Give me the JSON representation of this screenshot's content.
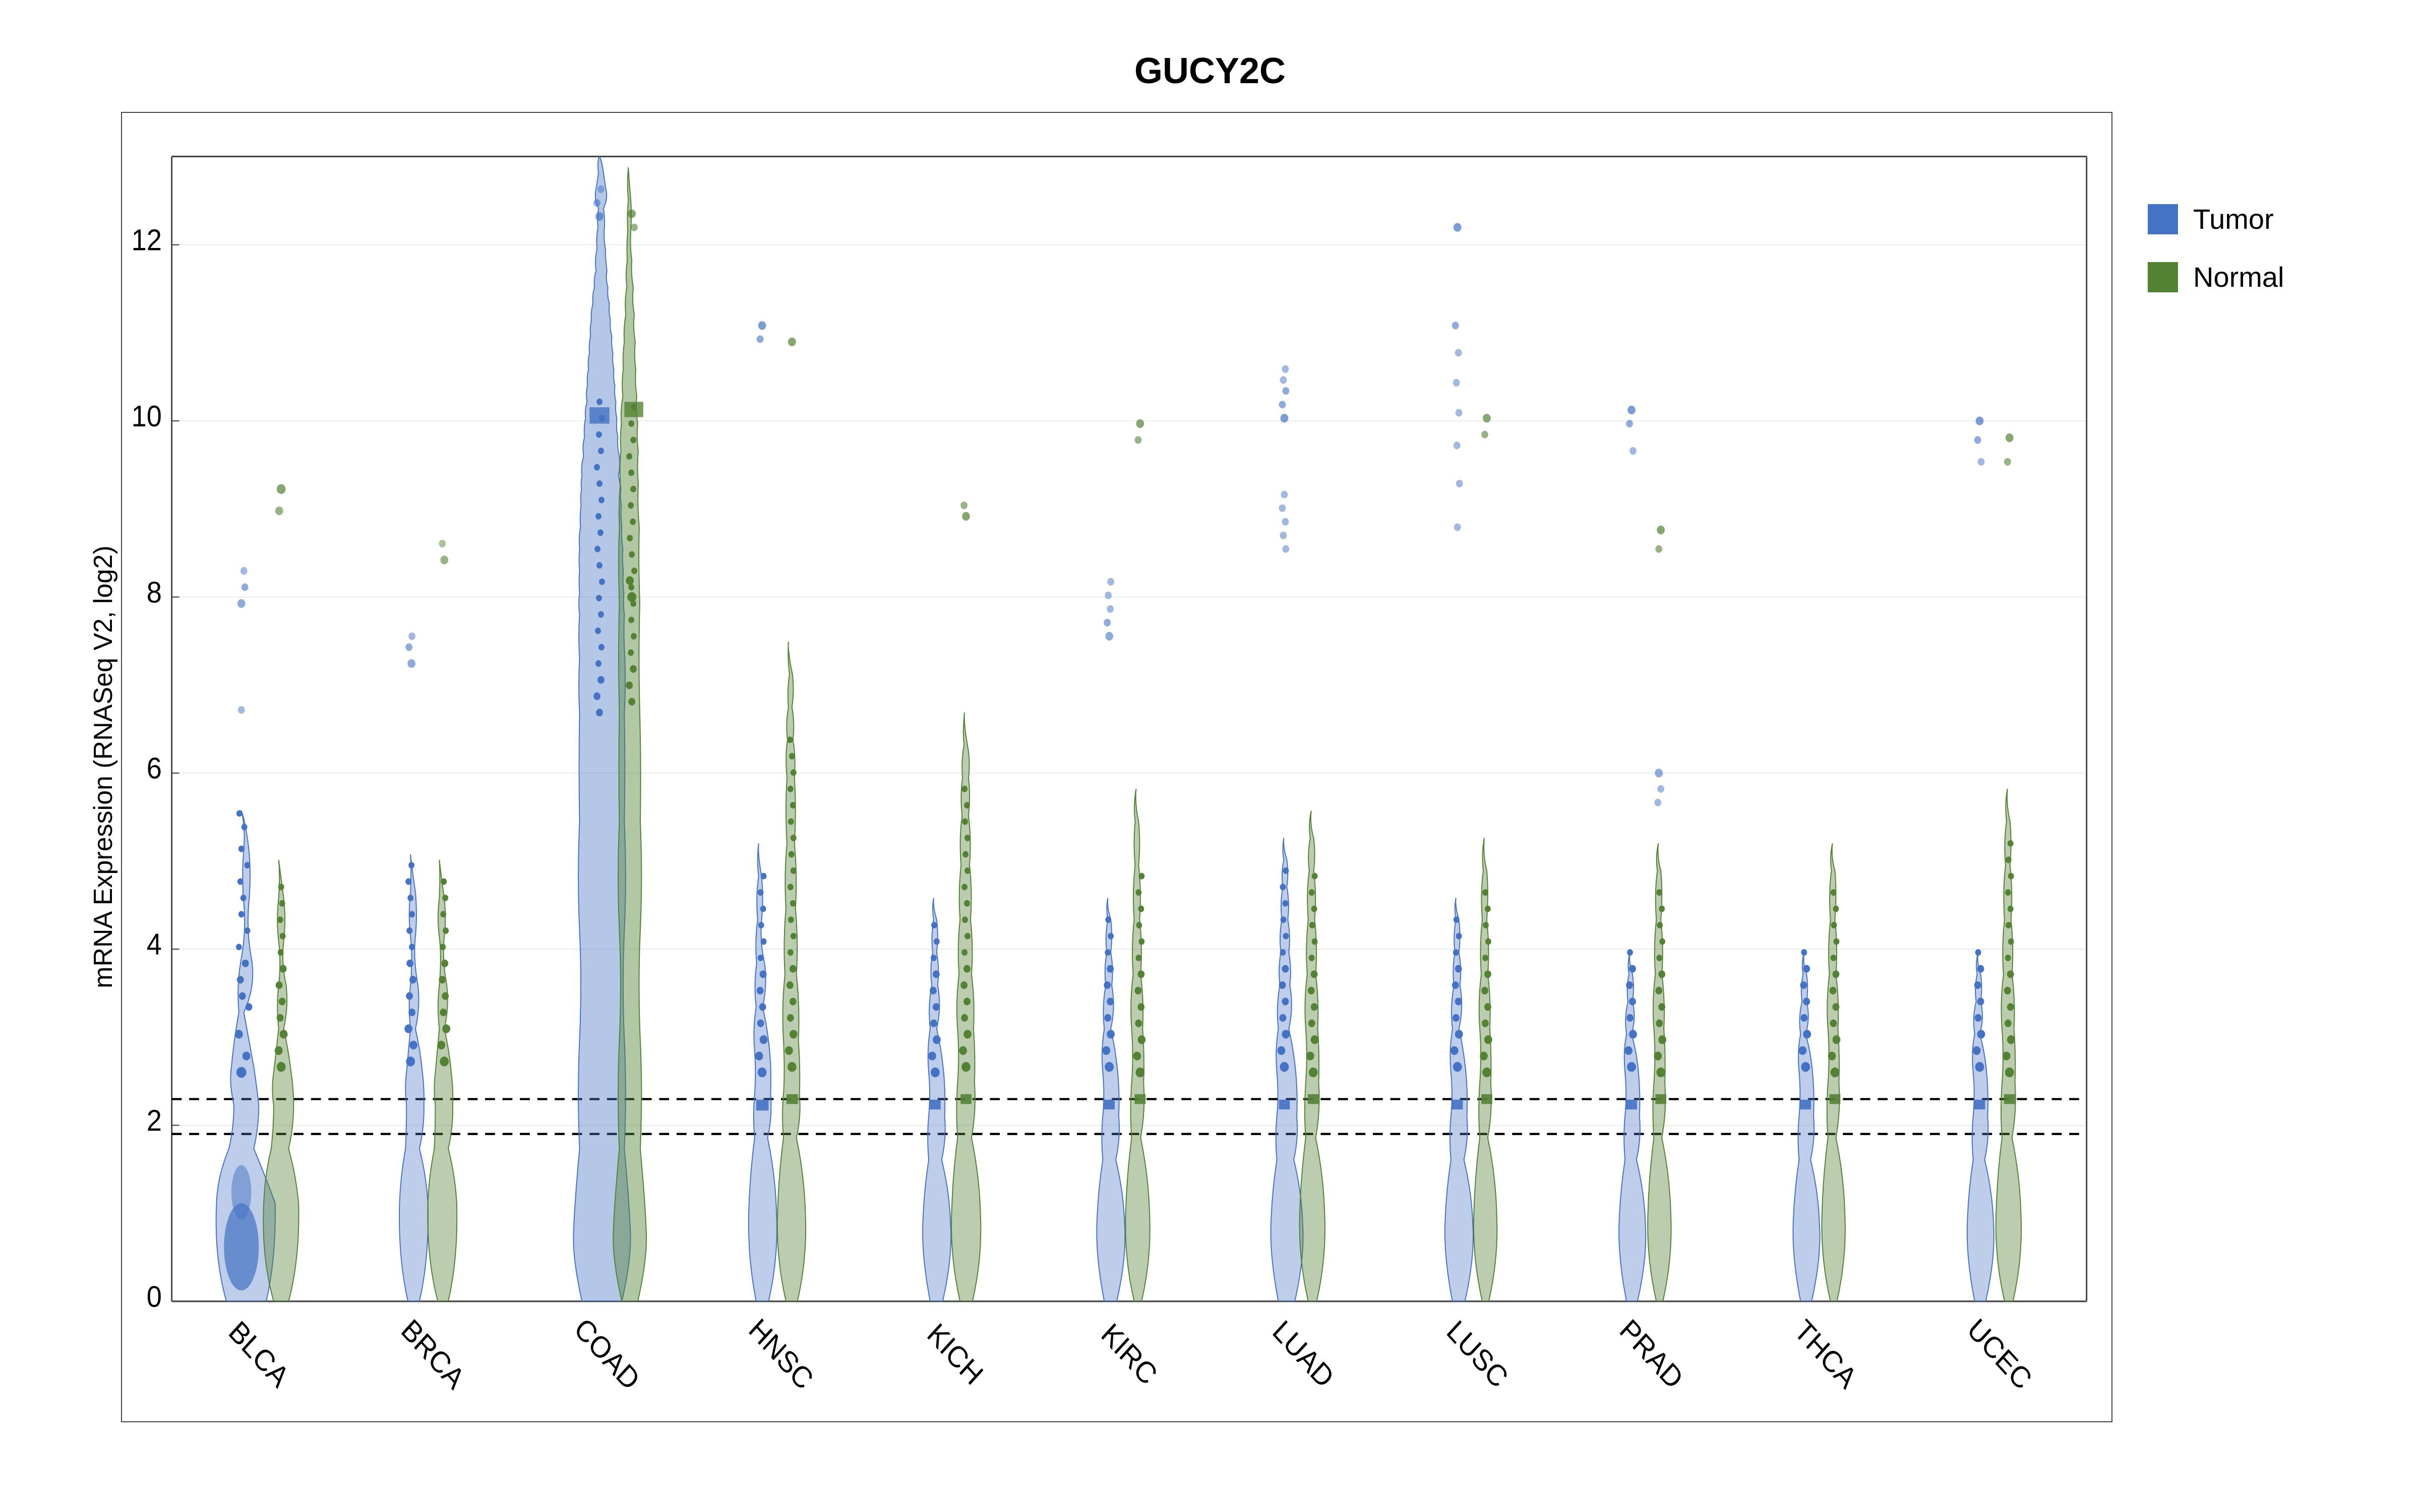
{
  "title": "GUCY2C",
  "yAxisLabel": "mRNA Expression (RNASeq V2, log2)",
  "legend": {
    "items": [
      {
        "label": "Tumor",
        "color": "#4472C4",
        "name": "tumor"
      },
      {
        "label": "Normal",
        "color": "#548235",
        "name": "normal"
      }
    ]
  },
  "xLabels": [
    "BLCA",
    "BRCA",
    "COAD",
    "HNSC",
    "KICH",
    "KIRC",
    "LUAD",
    "LUSC",
    "PRAD",
    "THCA",
    "UCEC"
  ],
  "yTicks": [
    0,
    2,
    4,
    6,
    8,
    10,
    12
  ],
  "dottedLines": [
    1.9,
    2.3
  ],
  "colors": {
    "tumor": "#4472C4",
    "normal": "#548235",
    "border": "#444444",
    "background": "#ffffff"
  }
}
